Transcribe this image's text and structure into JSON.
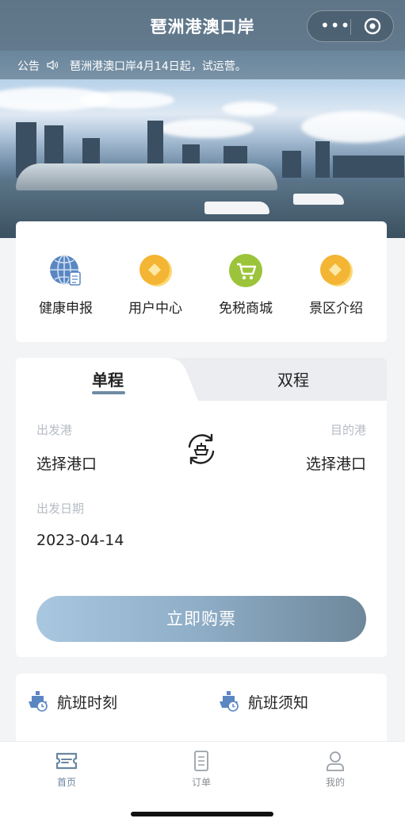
{
  "header": {
    "title": "琶洲港澳口岸",
    "capsule_more": "•••"
  },
  "notice": {
    "label": "公告",
    "icon": "speaker-icon",
    "text": "琶洲港澳口岸4月14日起，试运营。"
  },
  "quick_entries": [
    {
      "label": "健康申报",
      "icon": "globe-doc-icon",
      "color": "#5a86c2"
    },
    {
      "label": "用户中心",
      "icon": "diamond-coin-icon",
      "color": "#f3b533"
    },
    {
      "label": "免税商城",
      "icon": "shopping-cart-icon",
      "color": "#9bc43a"
    },
    {
      "label": "景区介绍",
      "icon": "diamond-coin-icon",
      "color": "#f3b533"
    }
  ],
  "ticket": {
    "tab_single": "单程",
    "tab_round": "双程",
    "depart_port_label": "出发港",
    "depart_port_value": "选择港口",
    "arrive_port_label": "目的港",
    "arrive_port_value": "选择港口",
    "date_label": "出发日期",
    "date_value": "2023-04-14",
    "buy_label": "立即购票",
    "accent_color": "#6f8ca5"
  },
  "flight_info": [
    {
      "label": "航班时刻",
      "icon": "ship-clock-icon"
    },
    {
      "label": "航班须知",
      "icon": "ship-clock-icon"
    }
  ],
  "tabbar": [
    {
      "label": "首页",
      "icon": "ticket-home-icon",
      "active": true
    },
    {
      "label": "订单",
      "icon": "document-icon",
      "active": false
    },
    {
      "label": "我的",
      "icon": "user-icon",
      "active": false
    }
  ]
}
